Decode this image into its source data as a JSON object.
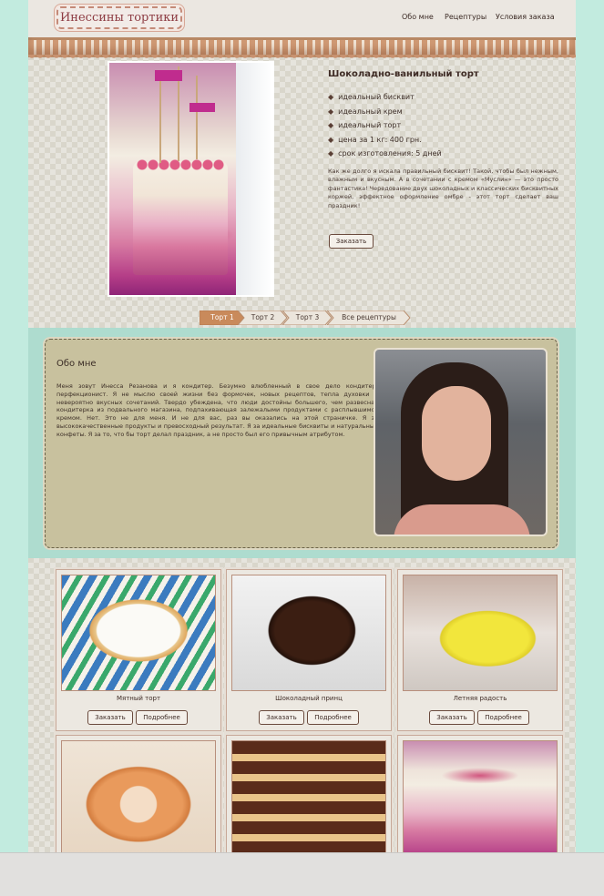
{
  "header": {
    "logo": "Инессины тортики",
    "nav": [
      "Обо мне",
      "Рецептуры",
      "Условия заказа"
    ]
  },
  "hero": {
    "title": "Шоколадно-ванильный торт",
    "features": [
      "идеальный бисквит",
      "идеальный крем",
      "идеальный торт",
      "цена за 1 кг: 400 грн.",
      "срок изготовления: 5 дней"
    ],
    "description": "Как же долго я искала правильный бисквит! Такой, чтобы был нежным, влажным и вкусным. А в сочетании с кремом «Муслин» — это просто фантастика! Чередование двух шоколадных и классических бисквитных коржей, эффектное оформление омбре - этот торт сделает ваш праздник!",
    "order_label": "Заказать"
  },
  "slider": {
    "tabs": [
      "Торт 1",
      "Торт 2",
      "Торт 3",
      "Все рецептуры"
    ],
    "active_color": "#c98a5b"
  },
  "about": {
    "title": "Обо мне",
    "text": "Меня зовут Инесса Резанова и я кондитер. Безумно влюбленный в свое дело кондитер-перфекционист. Я не мыслю своей жизни без формочек, новых рецептов, тепла духовки и невероятно вкусных сочетаний. Твердо убеждена, что люди достойны большего, чем развесная кондитерка из подвального магазина, подпахивающая залежалыми продуктами с расплывшимся кремом. Нет. Это не для меня. И не для вас, раз вы оказались на этой страничке. Я за высококачественные продукты и превосходный результат. Я за идеальные бисквиты и натуральные конфеты. Я за то, что бы торт делал праздник, а не просто был его привычным атрибутом."
  },
  "products": {
    "order_label": "Заказать",
    "more_label": "Подробнее",
    "items": [
      {
        "name": "Мятный торт"
      },
      {
        "name": "Шоколадный принц"
      },
      {
        "name": "Летняя радость"
      },
      {
        "name": ""
      },
      {
        "name": ""
      },
      {
        "name": ""
      }
    ]
  },
  "colors": {
    "background": "#c2ebdf",
    "about_band": "#aedccf",
    "about_box": "#c8c19e",
    "logo_text": "#8d3b42"
  }
}
